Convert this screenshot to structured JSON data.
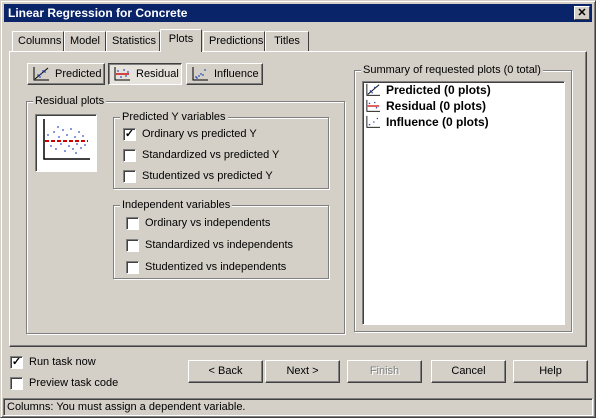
{
  "window": {
    "title": "Linear Regression for Concrete",
    "close_glyph": "✕"
  },
  "tabs": [
    {
      "label": "Columns"
    },
    {
      "label": "Model"
    },
    {
      "label": "Statistics"
    },
    {
      "label": "Plots",
      "active": true
    },
    {
      "label": "Predictions"
    },
    {
      "label": "Titles"
    }
  ],
  "plot_buttons": {
    "predicted": "Predicted",
    "residual": "Residual",
    "influence": "Influence"
  },
  "residual_plots": {
    "label": "Residual plots",
    "predicted_y": {
      "label": "Predicted Y variables",
      "options": [
        {
          "label": "Ordinary vs predicted Y",
          "checked": true
        },
        {
          "label": "Standardized vs predicted Y",
          "checked": false
        },
        {
          "label": "Studentized vs predicted Y",
          "checked": false
        }
      ]
    },
    "independent": {
      "label": "Independent variables",
      "options": [
        {
          "label": "Ordinary vs independents",
          "checked": false
        },
        {
          "label": "Standardized vs independents",
          "checked": false
        },
        {
          "label": "Studentized vs independents",
          "checked": false
        }
      ]
    }
  },
  "summary": {
    "label": "Summary of requested plots (0 total)",
    "items": [
      {
        "label": "Predicted (0 plots)",
        "icon": "predicted-plot-icon"
      },
      {
        "label": "Residual (0 plots)",
        "icon": "residual-plot-icon"
      },
      {
        "label": "Influence (0 plots)",
        "icon": "influence-plot-icon"
      }
    ]
  },
  "options": {
    "run_task_now": {
      "label": "Run task now",
      "checked": true
    },
    "preview_task_code": {
      "label": "Preview task code",
      "checked": false
    }
  },
  "buttons": {
    "back": "< Back",
    "next": "Next >",
    "finish": "Finish",
    "cancel": "Cancel",
    "help": "Help"
  },
  "status": "Columns: You must assign a dependent variable.",
  "colors": {
    "titlebar": "#0a246a",
    "face": "#d4d0c8",
    "residual_line": "#cc0000",
    "scatter_dots": "#3050c0"
  }
}
